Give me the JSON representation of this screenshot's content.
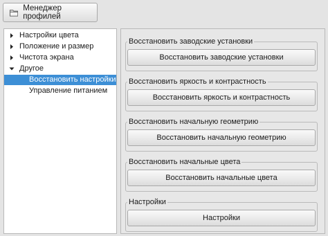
{
  "toolbar": {
    "profile_manager_label": "Менеджер профилей",
    "icon": "folder-icon"
  },
  "sidebar": {
    "items": [
      {
        "label": "Настройки цвета",
        "expanded": false,
        "level": 0
      },
      {
        "label": "Положение и размер",
        "expanded": false,
        "level": 0
      },
      {
        "label": "Чистота экрана",
        "expanded": false,
        "level": 0
      },
      {
        "label": "Другое",
        "expanded": true,
        "level": 0
      },
      {
        "label": "Восстановить настройки",
        "selected": true,
        "level": 1
      },
      {
        "label": "Управление питанием",
        "level": 1
      }
    ],
    "selection_color": "#3d8fd6"
  },
  "main": {
    "groups": [
      {
        "title": "Восстановить заводские установки",
        "button": "Восстановить заводские установки"
      },
      {
        "title": "Восстановить яркость и контрастность",
        "button": "Восстановить яркость и контрастность"
      },
      {
        "title": "Восстановить начальную геометрию",
        "button": "Восстановить начальную геометрию"
      },
      {
        "title": "Восстановить начальные цвета",
        "button": "Восстановить начальные цвета"
      },
      {
        "title": "Настройки",
        "button": "Настройки"
      }
    ]
  }
}
